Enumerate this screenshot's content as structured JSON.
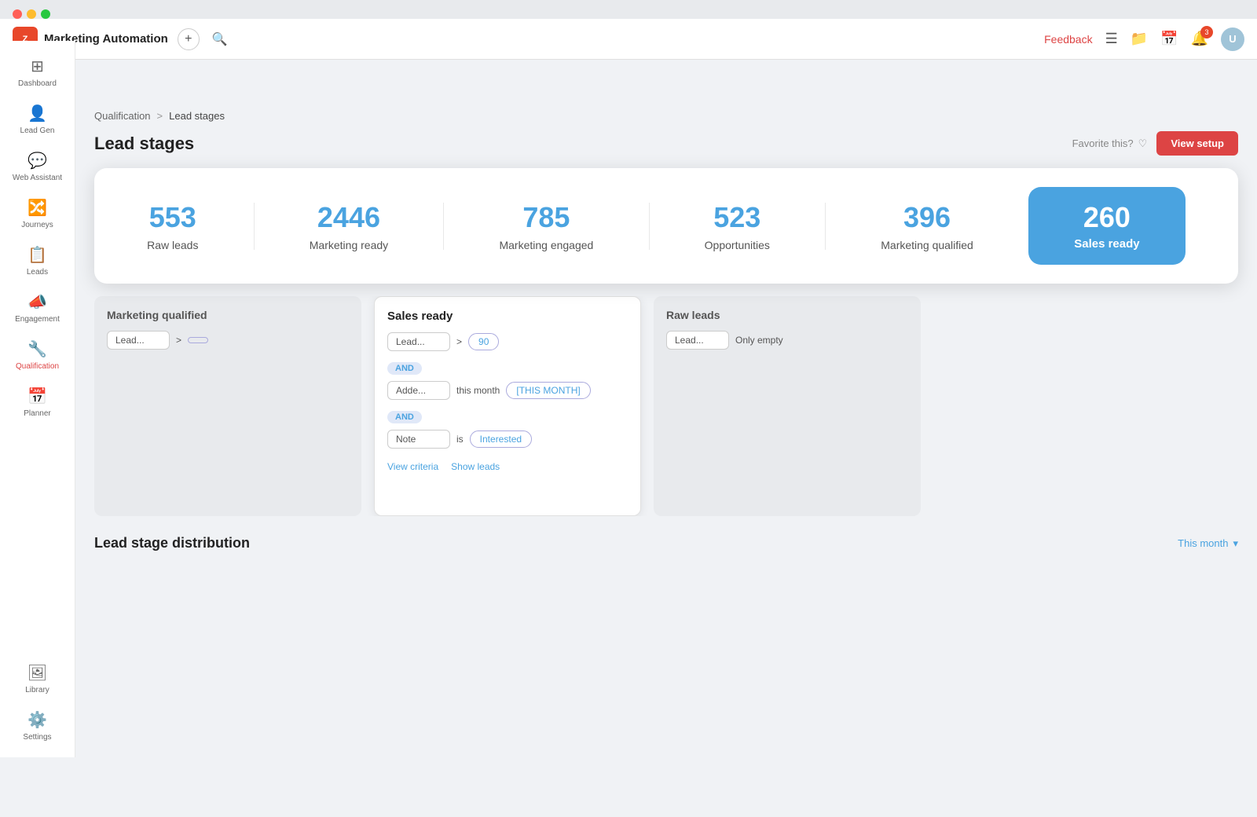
{
  "window": {
    "chrome_dots": [
      "red",
      "yellow",
      "green"
    ]
  },
  "topbar": {
    "logo_text": "Z",
    "title": "Marketing Automation",
    "add_icon": "+",
    "search_icon": "🔍",
    "feedback_label": "Feedback",
    "notif_count": "3",
    "avatar_letter": "U"
  },
  "sidebar": {
    "items": [
      {
        "id": "dashboard",
        "label": "Dashboard",
        "icon": "⊞"
      },
      {
        "id": "lead-gen",
        "label": "Lead Gen",
        "icon": "👤"
      },
      {
        "id": "web-assistant",
        "label": "Web Assistant",
        "icon": "💬"
      },
      {
        "id": "journeys",
        "label": "Journeys",
        "icon": "🔀"
      },
      {
        "id": "leads",
        "label": "Leads",
        "icon": "📋"
      },
      {
        "id": "engagement",
        "label": "Engagement",
        "icon": "📣"
      },
      {
        "id": "qualification",
        "label": "Qualification",
        "icon": "🔧",
        "active": true
      },
      {
        "id": "planner",
        "label": "Planner",
        "icon": "📅"
      },
      {
        "id": "library",
        "label": "Library",
        "icon": "🖼"
      },
      {
        "id": "settings",
        "label": "Settings",
        "icon": "⚙️"
      }
    ]
  },
  "breadcrumb": {
    "parent": "Qualification",
    "separator": ">",
    "current": "Lead stages"
  },
  "page": {
    "title": "Lead stages",
    "favorite_label": "Favorite this?",
    "view_setup_label": "View setup"
  },
  "stats": {
    "items": [
      {
        "number": "553",
        "label": "Raw leads"
      },
      {
        "number": "2446",
        "label": "Marketing ready"
      },
      {
        "number": "785",
        "label": "Marketing engaged"
      },
      {
        "number": "523",
        "label": "Opportunities"
      },
      {
        "number": "396",
        "label": "Marketing qualified"
      }
    ],
    "sales_ready": {
      "number": "260",
      "label": "Sales ready"
    }
  },
  "board": {
    "cards": [
      {
        "id": "marketing-qualified",
        "title": "Marketing qualified",
        "filters": [
          {
            "field": "Lead...",
            "op": ">",
            "value": ""
          }
        ]
      },
      {
        "id": "sales-ready",
        "title": "Sales ready",
        "filters": [
          {
            "field": "Lead...",
            "op": ">",
            "value": "90"
          },
          {
            "and": true
          },
          {
            "field": "Adde...",
            "op": "this month",
            "value": "[THIS MONTH]"
          },
          {
            "and": true
          },
          {
            "field": "Note",
            "op": "is",
            "value": "Interested"
          }
        ],
        "links": [
          {
            "label": "View criteria"
          },
          {
            "label": "Show leads"
          }
        ]
      },
      {
        "id": "raw-leads",
        "title": "Raw leads",
        "filters": [
          {
            "field": "Lead...",
            "op": "Only empty",
            "value": ""
          }
        ]
      }
    ]
  },
  "distribution": {
    "title": "Lead stage distribution",
    "filter_label": "This month",
    "chevron": "▾"
  }
}
